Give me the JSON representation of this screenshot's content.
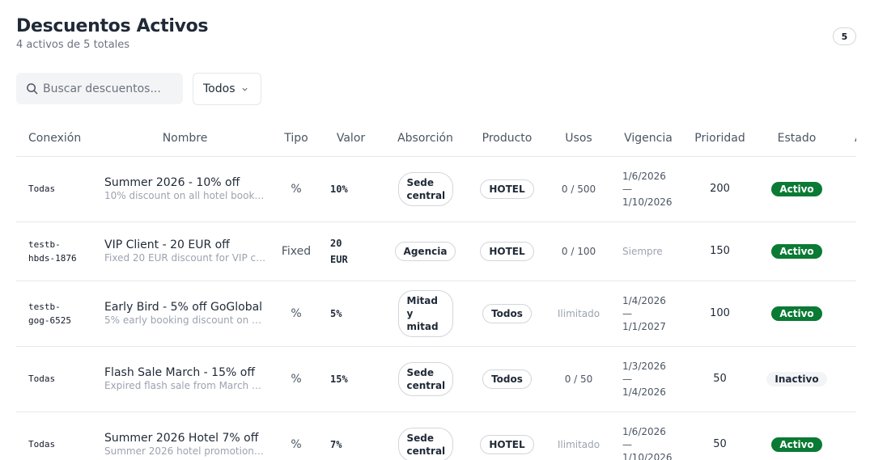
{
  "header": {
    "title": "Descuentos Activos",
    "subtitle": "4 activos de 5 totales",
    "count_badge": "5"
  },
  "search": {
    "placeholder": "Buscar descuentos..."
  },
  "filter": {
    "selected": "Todos"
  },
  "colors": {
    "active": "#0a7a34",
    "inactive_bg": "#f3f4f6"
  },
  "table": {
    "columns": [
      "Conexión",
      "Nombre",
      "Tipo",
      "Valor",
      "Absorción",
      "Producto",
      "Usos",
      "Vigencia",
      "Prioridad",
      "Estado",
      "Acciones"
    ],
    "rows": [
      {
        "conexion": "Todas",
        "name": "Summer 2026 - 10% off",
        "desc": "10% discount on all hotel bookings …",
        "tipo": "%",
        "valor": "10%",
        "absorcion": "Sede central",
        "producto": "HOTEL",
        "usos": "0 / 500",
        "vigencia": "1/6/2026\n—\n1/10/2026",
        "prioridad": "200",
        "estado": "Activo"
      },
      {
        "conexion": "testb-\nhbds-1876",
        "name": "VIP Client - 20 EUR off",
        "desc": "Fixed 20 EUR discount for VIP clien…",
        "tipo": "Fixed",
        "valor": "20\nEUR",
        "absorcion": "Agencia",
        "producto": "HOTEL",
        "usos": "0 / 100",
        "vigencia": "Siempre",
        "prioridad": "150",
        "estado": "Activo"
      },
      {
        "conexion": "testb-\ngog-6525",
        "name": "Early Bird - 5% off GoGlobal",
        "desc": "5% early booking discount on GoGl…",
        "tipo": "%",
        "valor": "5%",
        "absorcion": "Mitad y mitad",
        "producto": "Todos",
        "usos": "Ilimitado",
        "vigencia": "1/4/2026\n—\n1/1/2027",
        "prioridad": "100",
        "estado": "Activo"
      },
      {
        "conexion": "Todas",
        "name": "Flash Sale March - 15% off",
        "desc": "Expired flash sale from March 2026.",
        "tipo": "%",
        "valor": "15%",
        "absorcion": "Sede central",
        "producto": "Todos",
        "usos": "0 / 50",
        "vigencia": "1/3/2026\n—\n1/4/2026",
        "prioridad": "50",
        "estado": "Inactivo"
      },
      {
        "conexion": "Todas",
        "name": "Summer 2026 Hotel 7% off",
        "desc": "Summer 2026 hotel promotion, org…",
        "tipo": "%",
        "valor": "7%",
        "absorcion": "Sede central",
        "producto": "HOTEL",
        "usos": "Ilimitado",
        "vigencia": "1/6/2026\n—\n1/10/2026",
        "prioridad": "50",
        "estado": "Activo"
      }
    ]
  }
}
